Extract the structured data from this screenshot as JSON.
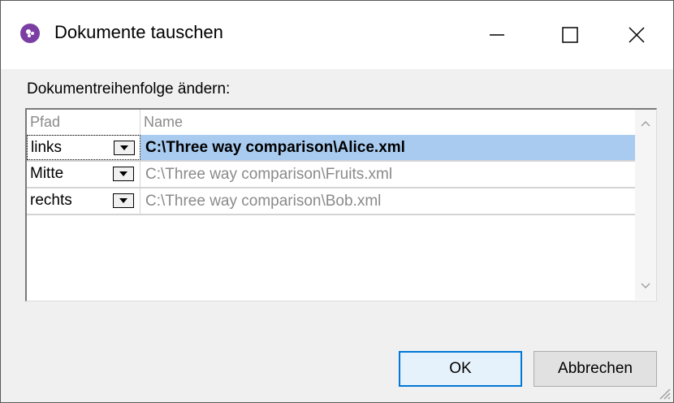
{
  "window": {
    "title": "Dokumente tauschen"
  },
  "dialog": {
    "section_label": "Dokumentreihenfolge ändern:",
    "columns": {
      "pfad": "Pfad",
      "name": "Name"
    },
    "rows": [
      {
        "pfad": "links",
        "name": "C:\\Three way comparison\\Alice.xml",
        "selected": true
      },
      {
        "pfad": "Mitte",
        "name": "C:\\Three way comparison\\Fruits.xml",
        "selected": false
      },
      {
        "pfad": "rechts",
        "name": "C:\\Three way comparison\\Bob.xml",
        "selected": false
      }
    ],
    "ok_label": "OK",
    "cancel_label": "Abbrechen"
  },
  "icons": {
    "app": "app-logo-icon",
    "minimize": "minimize-icon",
    "maximize": "maximize-icon",
    "close": "close-icon",
    "dropdown": "chevron-down-icon",
    "scroll_up": "scroll-up-icon",
    "scroll_down": "scroll-down-icon"
  },
  "colors": {
    "selection": "#a9cbf0",
    "accent": "#0078d7",
    "app_icon": "#7b3fa4"
  }
}
